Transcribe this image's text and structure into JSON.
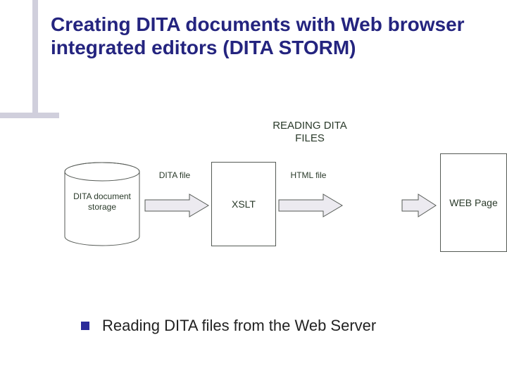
{
  "title": "Creating DITA documents with Web browser integrated editors (DITA STORM)",
  "diagram": {
    "heading_line1": "READING DITA",
    "heading_line2": "FILES",
    "storage_label_line1": "DITA document",
    "storage_label_line2": "storage",
    "arrow1_label": "DITA file",
    "box_xslt": "XSLT",
    "arrow2_label": "HTML file",
    "box_web": "WEB Page"
  },
  "bullet": "Reading DITA files from the Web Server"
}
